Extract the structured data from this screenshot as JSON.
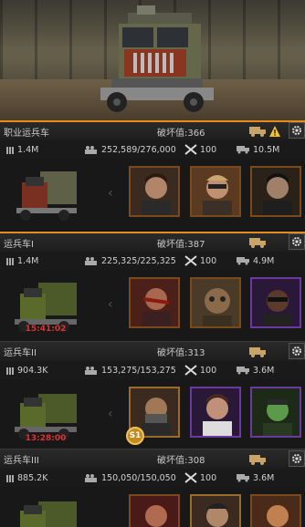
{
  "colors": {
    "accent": "#e88b1c",
    "timer": "#dd3333",
    "warning": "#f2c230"
  },
  "rows": [
    {
      "title": "职业运兵车",
      "damage": "破坏值:366",
      "warning": true,
      "ammo": "1.4M",
      "capacity": "252,589/276,000",
      "level": "100",
      "load": "10.5M",
      "timer": ""
    },
    {
      "title": "运兵车I",
      "damage": "破坏值:387",
      "warning": false,
      "ammo": "1.4M",
      "capacity": "225,325/225,325",
      "level": "100",
      "load": "4.9M",
      "timer": "15:41:02"
    },
    {
      "title": "运兵车II",
      "damage": "破坏值:313",
      "warning": false,
      "ammo": "904.3K",
      "capacity": "153,275/153,275",
      "level": "100",
      "load": "3.6M",
      "timer": "13:28:00",
      "badge": "S1"
    },
    {
      "title": "运兵车III",
      "damage": "破坏值:308",
      "warning": false,
      "ammo": "885.2K",
      "capacity": "150,050/150,050",
      "level": "100",
      "load": "3.6M",
      "timer": ""
    }
  ]
}
